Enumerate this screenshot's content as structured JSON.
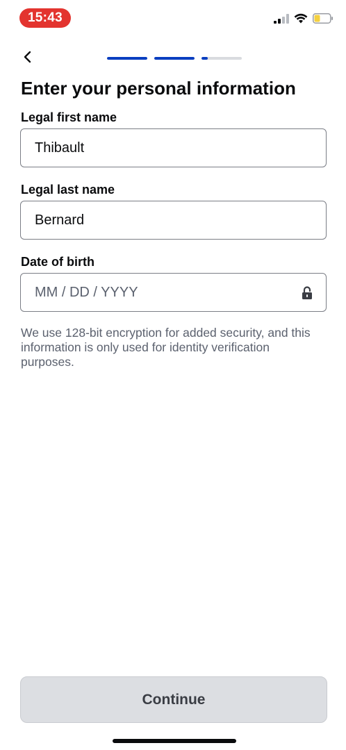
{
  "status_bar": {
    "time": "15:43",
    "time_pill_color": "#e3342f",
    "battery_color": "#f4d03f",
    "icons": [
      "cellular-signal-icon",
      "wifi-icon",
      "battery-icon"
    ]
  },
  "nav": {
    "back_icon": "chevron-left-icon",
    "progress": {
      "segments_total": 3,
      "segment_fill_levels": [
        1.0,
        1.0,
        0.15
      ],
      "accent_color": "#0a3fc0"
    }
  },
  "page": {
    "title": "Enter your personal information"
  },
  "fields": {
    "first_name": {
      "label": "Legal first name",
      "value": "Thibault"
    },
    "last_name": {
      "label": "Legal last name",
      "value": "Bernard"
    },
    "dob": {
      "label": "Date of birth",
      "value": "",
      "placeholder": "MM / DD / YYYY",
      "icon": "lock-icon"
    }
  },
  "helper_text": "We use 128-bit encryption for added security, and this information is only used for identity verification purposes.",
  "continue_label": "Continue"
}
